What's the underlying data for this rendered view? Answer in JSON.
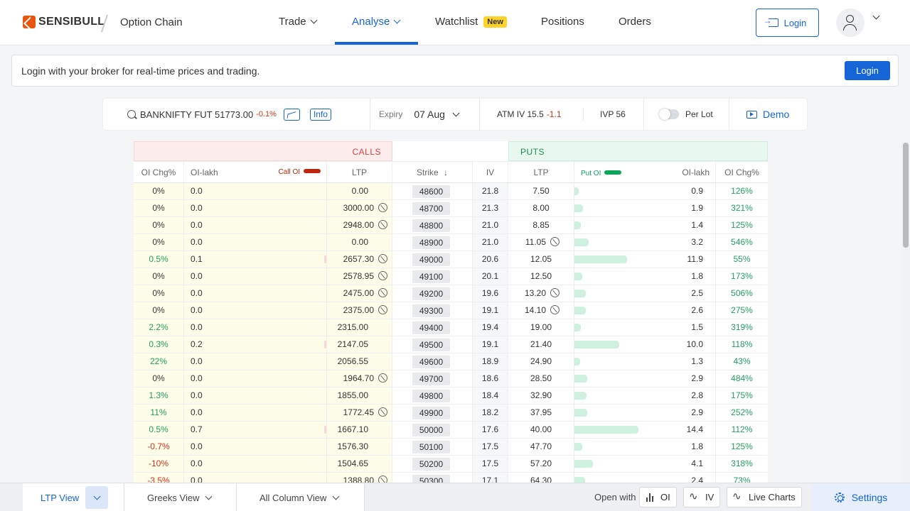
{
  "header": {
    "logo": "SENSIBULL",
    "page_title": "Option Chain",
    "nav": [
      {
        "label": "Trade"
      },
      {
        "label": "Analyse"
      },
      {
        "label": "Watchlist",
        "badge": "New"
      },
      {
        "label": "Positions"
      },
      {
        "label": "Orders"
      }
    ],
    "login": "Login"
  },
  "banner": {
    "text": "Login with your broker for real-time prices and trading.",
    "button": "Login"
  },
  "toolbar": {
    "symbol": "BANKNIFTY FUT 51773.00",
    "change": "-0.1%",
    "info": "Info",
    "expiry_label": "Expiry",
    "expiry_value": "07 Aug",
    "atm_iv_label": "ATM IV 15.5",
    "atm_iv_change": "-1.1",
    "ivp": "IVP 56",
    "per_lot": "Per Lot",
    "demo": "Demo"
  },
  "chain": {
    "calls_label": "CALLS",
    "puts_label": "PUTS",
    "columns": {
      "call_oi_chg": "OI Chg%",
      "call_oi_lakh": "OI-lakh",
      "call_oi_legend": "Call OI",
      "call_ltp": "LTP",
      "strike": "Strike",
      "iv": "IV",
      "put_ltp": "LTP",
      "put_oi_legend": "Put OI",
      "put_oi_lakh": "OI-lakh",
      "put_oi_chg": "OI Chg%"
    },
    "colors": {
      "call_oi_bar": "#c0260f",
      "put_oi_bar": "#0aa45a",
      "positive": "#21a05d",
      "negative": "#d0321b"
    },
    "rows": [
      {
        "call_oi_chg": "0%",
        "call_oi": "0.0",
        "call_ltp": "0.00",
        "call_icon": false,
        "strike": "48600",
        "iv": "21.8",
        "put_ltp": "7.50",
        "put_icon": false,
        "put_oi": "0.9",
        "put_oi_chg": "126%",
        "put_oi_value": 0.9
      },
      {
        "call_oi_chg": "0%",
        "call_oi": "0.0",
        "call_ltp": "3000.00",
        "call_icon": true,
        "strike": "48700",
        "iv": "21.3",
        "put_ltp": "8.00",
        "put_icon": false,
        "put_oi": "1.9",
        "put_oi_chg": "321%",
        "put_oi_value": 1.9
      },
      {
        "call_oi_chg": "0%",
        "call_oi": "0.0",
        "call_ltp": "2948.00",
        "call_icon": true,
        "strike": "48800",
        "iv": "21.0",
        "put_ltp": "8.85",
        "put_icon": false,
        "put_oi": "1.4",
        "put_oi_chg": "125%",
        "put_oi_value": 1.4
      },
      {
        "call_oi_chg": "0%",
        "call_oi": "0.0",
        "call_ltp": "0.00",
        "call_icon": false,
        "strike": "48900",
        "iv": "21.0",
        "put_ltp": "11.05",
        "put_icon": true,
        "put_oi": "3.2",
        "put_oi_chg": "546%",
        "put_oi_value": 3.2
      },
      {
        "call_oi_chg": "0.5%",
        "call_oi": "0.1",
        "call_ltp": "2657.30",
        "call_icon": true,
        "strike": "49000",
        "iv": "20.6",
        "put_ltp": "12.05",
        "put_icon": false,
        "put_oi": "11.9",
        "put_oi_chg": "55%",
        "put_oi_value": 11.9
      },
      {
        "call_oi_chg": "0%",
        "call_oi": "0.0",
        "call_ltp": "2578.95",
        "call_icon": true,
        "strike": "49100",
        "iv": "20.1",
        "put_ltp": "12.50",
        "put_icon": false,
        "put_oi": "1.8",
        "put_oi_chg": "173%",
        "put_oi_value": 1.8
      },
      {
        "call_oi_chg": "0%",
        "call_oi": "0.0",
        "call_ltp": "2475.00",
        "call_icon": true,
        "strike": "49200",
        "iv": "19.6",
        "put_ltp": "13.20",
        "put_icon": true,
        "put_oi": "2.5",
        "put_oi_chg": "506%",
        "put_oi_value": 2.5
      },
      {
        "call_oi_chg": "0%",
        "call_oi": "0.0",
        "call_ltp": "2375.00",
        "call_icon": true,
        "strike": "49300",
        "iv": "19.1",
        "put_ltp": "14.10",
        "put_icon": true,
        "put_oi": "2.6",
        "put_oi_chg": "275%",
        "put_oi_value": 2.6
      },
      {
        "call_oi_chg": "2.2%",
        "call_oi": "0.0",
        "call_ltp": "2315.00",
        "call_icon": false,
        "strike": "49400",
        "iv": "19.4",
        "put_ltp": "19.00",
        "put_icon": false,
        "put_oi": "1.5",
        "put_oi_chg": "319%",
        "put_oi_value": 1.5
      },
      {
        "call_oi_chg": "0.3%",
        "call_oi": "0.2",
        "call_ltp": "2147.05",
        "call_icon": false,
        "strike": "49500",
        "iv": "19.1",
        "put_ltp": "21.40",
        "put_icon": false,
        "put_oi": "10.0",
        "put_oi_chg": "118%",
        "put_oi_value": 10.0
      },
      {
        "call_oi_chg": "22%",
        "call_oi": "0.0",
        "call_ltp": "2056.55",
        "call_icon": false,
        "strike": "49600",
        "iv": "18.9",
        "put_ltp": "24.90",
        "put_icon": false,
        "put_oi": "1.3",
        "put_oi_chg": "43%",
        "put_oi_value": 1.3
      },
      {
        "call_oi_chg": "0%",
        "call_oi": "0.0",
        "call_ltp": "1964.70",
        "call_icon": true,
        "strike": "49700",
        "iv": "18.6",
        "put_ltp": "28.50",
        "put_icon": false,
        "put_oi": "2.9",
        "put_oi_chg": "484%",
        "put_oi_value": 2.9
      },
      {
        "call_oi_chg": "1.3%",
        "call_oi": "0.0",
        "call_ltp": "1855.00",
        "call_icon": false,
        "strike": "49800",
        "iv": "18.4",
        "put_ltp": "32.90",
        "put_icon": false,
        "put_oi": "2.8",
        "put_oi_chg": "175%",
        "put_oi_value": 2.8
      },
      {
        "call_oi_chg": "11%",
        "call_oi": "0.0",
        "call_ltp": "1772.45",
        "call_icon": true,
        "strike": "49900",
        "iv": "18.2",
        "put_ltp": "37.95",
        "put_icon": false,
        "put_oi": "2.9",
        "put_oi_chg": "252%",
        "put_oi_value": 2.9
      },
      {
        "call_oi_chg": "0.5%",
        "call_oi": "0.7",
        "call_ltp": "1667.10",
        "call_icon": false,
        "strike": "50000",
        "iv": "17.6",
        "put_ltp": "40.00",
        "put_icon": false,
        "put_oi": "14.4",
        "put_oi_chg": "112%",
        "put_oi_value": 14.4
      },
      {
        "call_oi_chg": "-0.7%",
        "call_oi": "0.0",
        "call_ltp": "1576.30",
        "call_icon": false,
        "strike": "50100",
        "iv": "17.5",
        "put_ltp": "47.70",
        "put_icon": false,
        "put_oi": "1.8",
        "put_oi_chg": "125%",
        "put_oi_value": 1.8
      },
      {
        "call_oi_chg": "-10%",
        "call_oi": "0.0",
        "call_ltp": "1504.65",
        "call_icon": false,
        "strike": "50200",
        "iv": "17.5",
        "put_ltp": "57.20",
        "put_icon": false,
        "put_oi": "4.1",
        "put_oi_chg": "318%",
        "put_oi_value": 4.1
      },
      {
        "call_oi_chg": "-3.5%",
        "call_oi": "0.0",
        "call_ltp": "1388.80",
        "call_icon": true,
        "strike": "50300",
        "iv": "17.1",
        "put_ltp": "64.30",
        "put_icon": false,
        "put_oi": "2.4",
        "put_oi_chg": "73%",
        "put_oi_value": 2.4
      }
    ]
  },
  "bottombar": {
    "ltp_view": "LTP View",
    "greeks_view": "Greeks View",
    "all_column_view": "All Column View",
    "open_with": "Open with",
    "oi": "OI",
    "iv": "IV",
    "live_charts": "Live Charts",
    "settings": "Settings"
  }
}
